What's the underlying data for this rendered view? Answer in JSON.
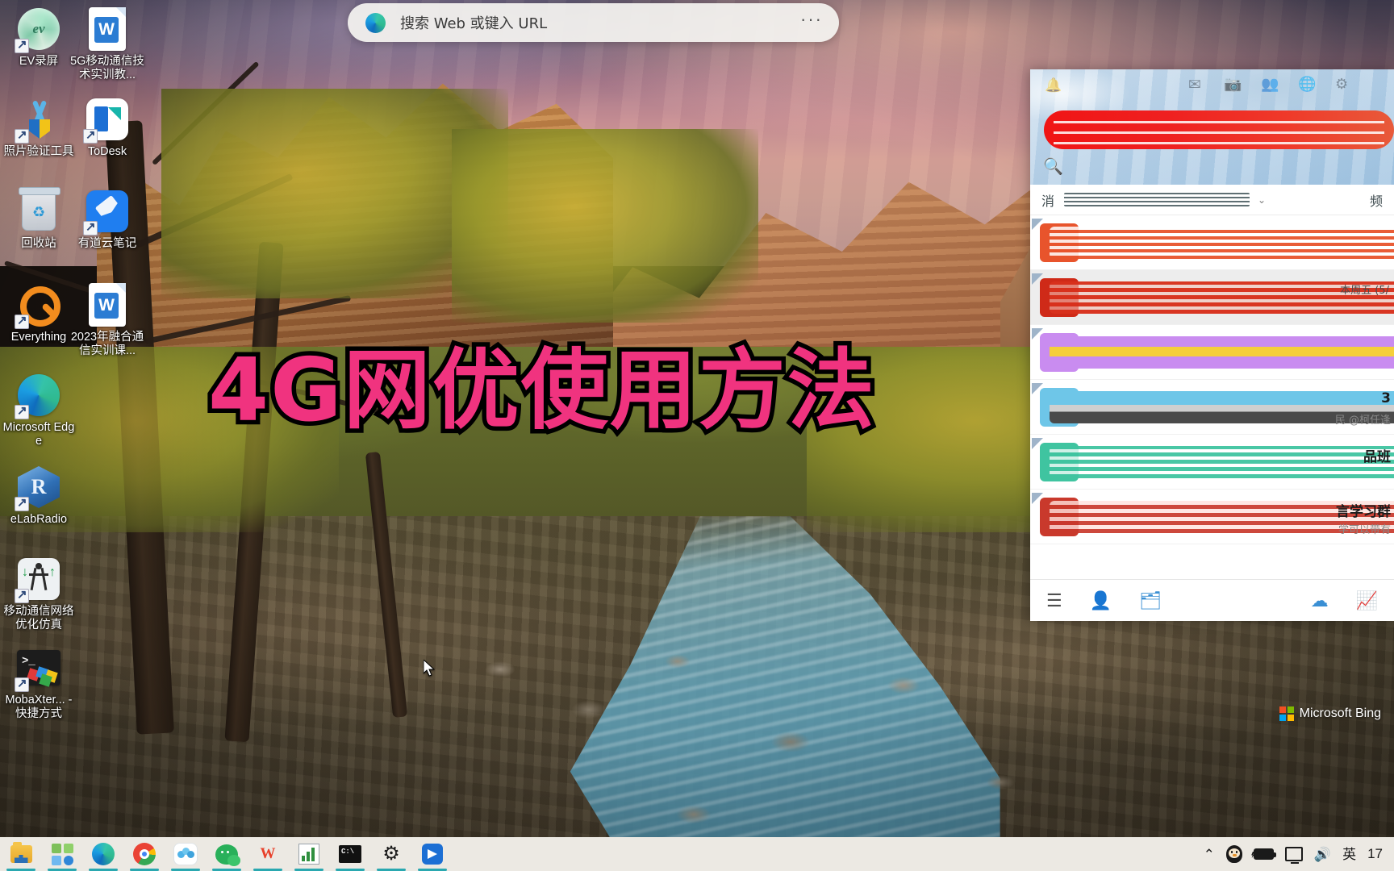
{
  "desktop": {
    "wallpaper_watermark": "Microsoft Bing",
    "overlay_title": "4G网优使用方法",
    "icons": [
      {
        "label": "EV录屏",
        "icon": "ev-recorder-icon",
        "shortcut": true
      },
      {
        "label": "5G移动通信技术实训教...",
        "icon": "word-document-icon",
        "shortcut": false
      },
      {
        "label": "照片验证工具",
        "icon": "photo-verify-tool-icon",
        "shortcut": true
      },
      {
        "label": "ToDesk",
        "icon": "todesk-icon",
        "shortcut": true
      },
      {
        "label": "回收站",
        "icon": "recycle-bin-icon",
        "shortcut": false
      },
      {
        "label": "有道云笔记",
        "icon": "youdao-note-icon",
        "shortcut": true
      },
      {
        "label": "Everything",
        "icon": "everything-search-icon",
        "shortcut": true
      },
      {
        "label": "2023年融合通信实训课...",
        "icon": "word-document-icon",
        "shortcut": false
      },
      {
        "label": "Microsoft Edge",
        "icon": "edge-browser-icon",
        "shortcut": true
      },
      {
        "label": "eLabRadio",
        "icon": "elabradio-icon",
        "shortcut": true
      },
      {
        "label": "移动通信网络优化仿真",
        "icon": "mobile-network-sim-icon",
        "shortcut": true
      },
      {
        "label": "MobaXter... - 快捷方式",
        "icon": "mobaxterm-icon",
        "shortcut": true
      }
    ]
  },
  "edge_search": {
    "placeholder": "搜索 Web 或键入 URL",
    "value": "",
    "more_label": "···",
    "logo": "edge-logo-icon"
  },
  "wechat": {
    "header": {
      "search_icon": "search-icon",
      "redacted_banner": true,
      "tray_icons": [
        "bell-icon",
        "mail-icon",
        "camera-icon",
        "group-icon",
        "globe-icon",
        "settings-icon"
      ]
    },
    "filter": {
      "selected_label": "消",
      "chevron": "⌄",
      "right_label": "频"
    },
    "conversations": [
      {
        "title": "",
        "subtitle": "",
        "time": "",
        "redact_color": "#e8542c",
        "avatar_color": "#e8542c",
        "muted": true,
        "selected": false
      },
      {
        "title": "",
        "subtitle": "",
        "time": "本周五 (5/",
        "redact_color": "#d8301c",
        "avatar_color": "#cf2a18",
        "muted": true,
        "selected": true
      },
      {
        "title": "",
        "subtitle": "",
        "time": "",
        "redact_color": "#c98cf0",
        "avatar_color": "#c98cf0",
        "muted": true,
        "selected": false
      },
      {
        "title": "3",
        "subtitle": "民 @柯任逢",
        "time": "",
        "redact_color": "#6ec6e8",
        "avatar_color": "#6ec6e8",
        "muted": true,
        "selected": false
      },
      {
        "title": "品班",
        "subtitle": "",
        "time": "",
        "redact_color": "#3fc4a0",
        "avatar_color": "#3fc4a0",
        "muted": true,
        "selected": false
      },
      {
        "title": "言学习群",
        "subtitle": "学可以带有",
        "time": "",
        "redact_color": "#c9392c",
        "avatar_color": "#c9392c",
        "muted": true,
        "selected": false
      }
    ],
    "toolbar": [
      {
        "name": "menu-icon",
        "glyph": "☰",
        "color": "dark"
      },
      {
        "name": "add-contact-icon",
        "glyph": "👤",
        "color": "blue"
      },
      {
        "name": "favorites-icon",
        "glyph": "🗂",
        "color": "blue"
      },
      {
        "name": "cloud-icon",
        "glyph": "☁",
        "color": "blue"
      },
      {
        "name": "trend-icon",
        "glyph": "📈",
        "color": "red"
      }
    ]
  },
  "taskbar": {
    "apps": [
      {
        "name": "file-explorer",
        "label": "文件资源管理器"
      },
      {
        "name": "app-tiles",
        "label": "应用"
      },
      {
        "name": "microsoft-edge",
        "label": "Microsoft Edge"
      },
      {
        "name": "google-chrome",
        "label": "Google Chrome"
      },
      {
        "name": "cloud-app",
        "label": "云盘"
      },
      {
        "name": "wechat",
        "label": "微信"
      },
      {
        "name": "wps-office",
        "label": "WPS Office"
      },
      {
        "name": "chart-app",
        "label": "图表工具"
      },
      {
        "name": "terminal",
        "label": "命令提示符"
      },
      {
        "name": "settings",
        "label": "设置"
      },
      {
        "name": "todesk",
        "label": "ToDesk"
      }
    ],
    "tray": {
      "chevron": "⌃",
      "qq": "qq-icon",
      "battery": "battery-icon",
      "display": "display-icon",
      "volume": "volume-icon",
      "ime": "英",
      "clock": "17"
    }
  }
}
